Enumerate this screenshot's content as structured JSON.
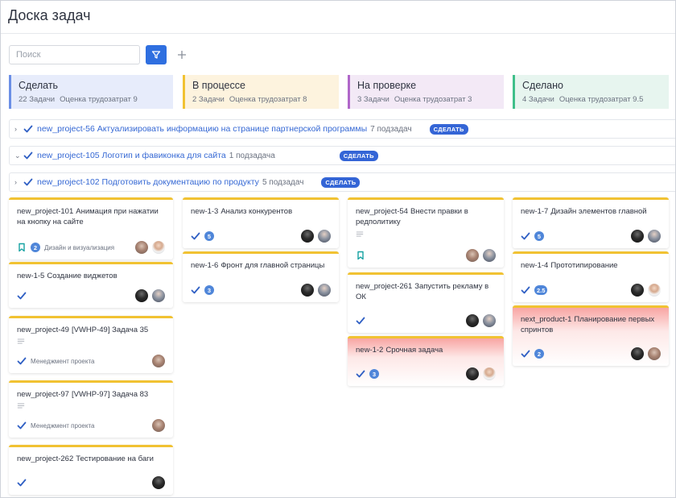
{
  "page": {
    "title": "Доска задач"
  },
  "toolbar": {
    "search_placeholder": "Поиск"
  },
  "colors": {
    "todo": "#e7ecfb",
    "progress": "#fdf3de",
    "review": "#f3e9f6",
    "done": "#e7f5ef",
    "accent": "#2f6fe0"
  },
  "columns": [
    {
      "name": "Сделать",
      "count": "22 Задачи",
      "estimate": "Оценка трудозатрат 9"
    },
    {
      "name": "В процессе",
      "count": "2 Задачи",
      "estimate": "Оценка трудозатрат 8"
    },
    {
      "name": "На проверке",
      "count": "3 Задачи",
      "estimate": "Оценка трудозатрат 3"
    },
    {
      "name": "Сделано",
      "count": "4 Задачи",
      "estimate": "Оценка трудозатрат 9.5"
    }
  ],
  "epics": [
    {
      "chevron": "›",
      "title": "new_project-56 Актуализировать информацию на странице партнерской программы",
      "subtasks": "7 подзадач",
      "badge": "СДЕЛАТЬ"
    },
    {
      "chevron": "⌄",
      "title": "new_project-105 Логотип и фавиконка для сайта",
      "subtasks": "1 подзадача",
      "badge": "СДЕЛАТЬ"
    },
    {
      "chevron": "›",
      "title": "new_project-102 Подготовить документацию по продукту",
      "subtasks": "5 подзадач",
      "badge": "СДЕЛАТЬ"
    }
  ],
  "cards": {
    "todo": [
      {
        "key": "new_project-101",
        "title": "Анимация при нажатии на кнопку на сайте",
        "badge": "2",
        "tag": "Дизайн и визуализация",
        "avatars": [
          "girl",
          "man"
        ]
      },
      {
        "key": "new-1-5",
        "title": "Создание виджетов",
        "avatars": [
          "dark",
          "glasses"
        ]
      },
      {
        "key": "new_project-49",
        "title": "[VWHP-49] Задача 35",
        "tag": "Менеджмент проекта",
        "avatars": [
          "girl"
        ]
      },
      {
        "key": "new_project-97",
        "title": "[VWHP-97] Задача 83",
        "tag": "Менеджмент проекта",
        "avatars": [
          "girl"
        ]
      },
      {
        "key": "new_project-262",
        "title": "Тестирование на баги",
        "avatars": [
          "dark"
        ]
      }
    ],
    "progress": [
      {
        "key": "new-1-3",
        "title": "Анализ конкурентов",
        "badge": "5",
        "avatars": [
          "dark",
          "glasses"
        ]
      },
      {
        "key": "new-1-6",
        "title": "Фронт для главной страницы",
        "badge": "3",
        "avatars": [
          "dark",
          "glasses"
        ]
      }
    ],
    "review": [
      {
        "key": "new_project-54",
        "title": "Внести правки в редполитику",
        "avatars": [
          "girl",
          "glasses"
        ]
      },
      {
        "key": "new_project-261",
        "title": "Запустить рекламу в ОК",
        "avatars": [
          "dark",
          "glasses"
        ]
      },
      {
        "key": "new-1-2",
        "title": "Срочная задача",
        "badge": "3",
        "avatars": [
          "dark",
          "man"
        ]
      }
    ],
    "done": [
      {
        "key": "new-1-7",
        "title": "Дизайн элементов главной",
        "badge": "5",
        "avatars": [
          "dark",
          "glasses"
        ]
      },
      {
        "key": "new-1-4",
        "title": "Прототипирование",
        "badge": "2.5",
        "avatars": [
          "dark",
          "man"
        ]
      },
      {
        "key": "next_product-1",
        "title": "Планирование первых спринтов",
        "badge": "2",
        "avatars": [
          "dark",
          "girl"
        ]
      }
    ]
  }
}
